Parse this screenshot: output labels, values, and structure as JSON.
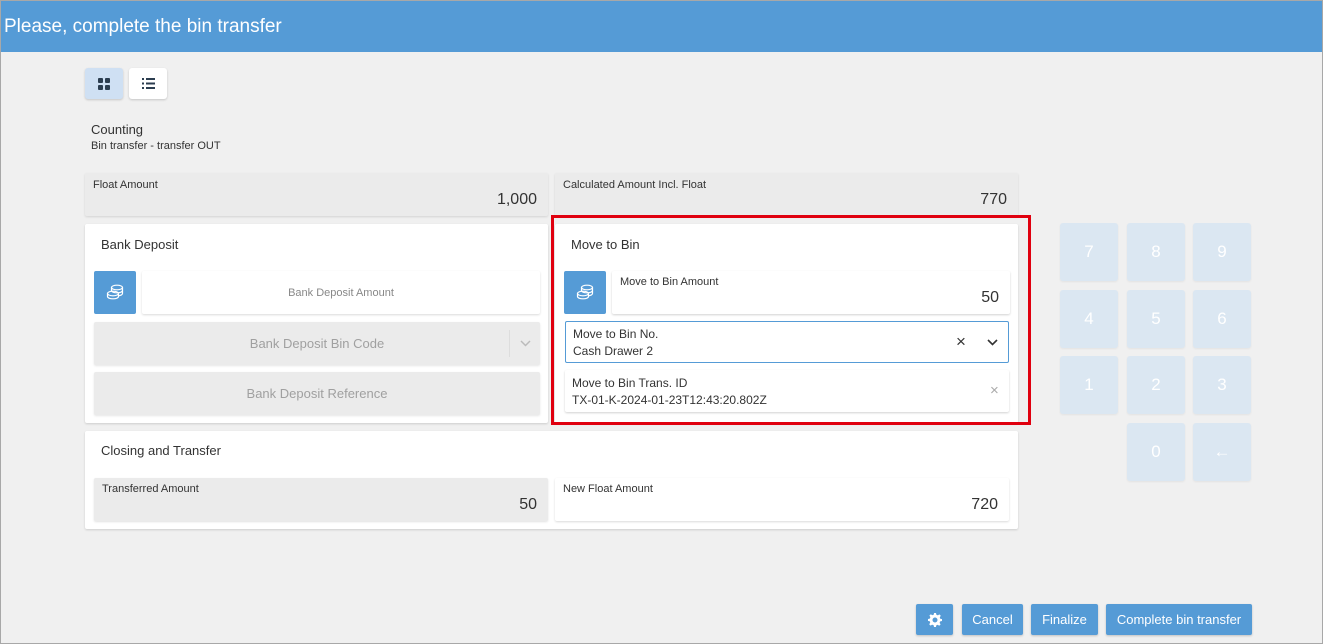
{
  "window": {
    "title": "Please, complete the bin transfer"
  },
  "view_toggle": {
    "grid_icon": "grid-icon",
    "list_icon": "list-icon"
  },
  "header": {
    "title": "Counting",
    "subtitle": "Bin transfer - transfer OUT"
  },
  "float_amount": {
    "label": "Float Amount",
    "value": "1,000"
  },
  "calculated_amount": {
    "label": "Calculated Amount Incl. Float",
    "value": "770"
  },
  "bank_deposit": {
    "title": "Bank Deposit",
    "amount_placeholder": "Bank Deposit Amount",
    "bin_code_placeholder": "Bank Deposit Bin Code",
    "reference_placeholder": "Bank Deposit Reference"
  },
  "move_to_bin": {
    "title": "Move to Bin",
    "amount_label": "Move to Bin Amount",
    "amount_value": "50",
    "bin_no_label": "Move to Bin No.",
    "bin_no_value": "Cash Drawer 2",
    "trans_id_label": "Move to Bin Trans. ID",
    "trans_id_value": "TX-01-K-2024-01-23T12:43:20.802Z",
    "clear_glyph": "×"
  },
  "closing": {
    "title": "Closing and Transfer",
    "transferred_label": "Transferred Amount",
    "transferred_value": "50",
    "new_float_label": "New Float Amount",
    "new_float_value": "720"
  },
  "keypad": {
    "keys": [
      "7",
      "8",
      "9",
      "4",
      "5",
      "6",
      "1",
      "2",
      "3",
      "0",
      "←"
    ]
  },
  "footer": {
    "settings_icon": "gear-icon",
    "cancel": "Cancel",
    "finalize": "Finalize",
    "complete": "Complete bin transfer"
  },
  "colors": {
    "accent": "#559bd6",
    "highlight": "#e0000f"
  }
}
